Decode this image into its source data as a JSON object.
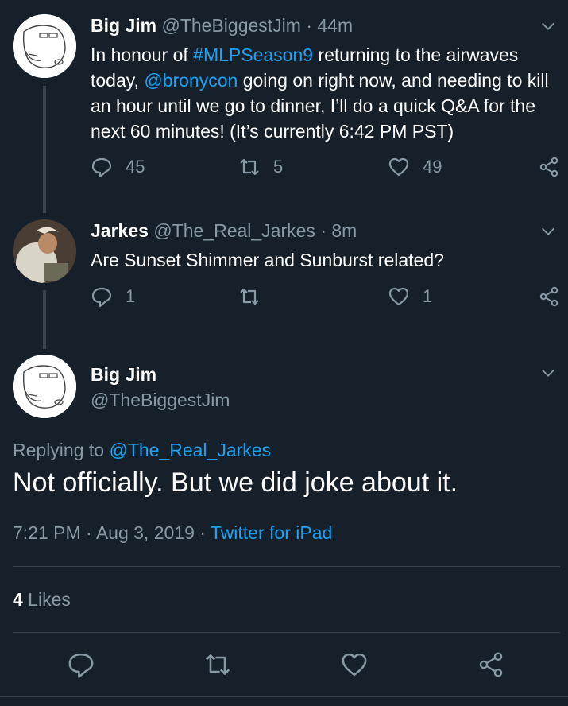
{
  "colors": {
    "background": "#15202b",
    "link": "#1da1f2",
    "muted": "#8899a6",
    "divider": "#38444d"
  },
  "tweet1": {
    "name": "Big Jim",
    "handle": "@TheBiggestJim",
    "separator": "·",
    "time": "44m",
    "text_before_hashtag": "In honour of ",
    "hashtag": "#MLPSeason9",
    "text_middle": " returning to the airwaves today, ",
    "mention": "@bronycon",
    "text_after": " going on right now, and needing to kill an hour until we go to dinner, I’ll do a quick Q&A for the next 60 minutes! (It’s currently 6:42 PM PST)",
    "replies": "45",
    "retweets": "5",
    "likes": "49"
  },
  "tweet2": {
    "name": "Jarkes",
    "handle": "@The_Real_Jarkes",
    "separator": "·",
    "time": "8m",
    "text": "Are Sunset Shimmer and Sunburst related?",
    "replies": "1",
    "retweets": "",
    "likes": "1"
  },
  "main_tweet": {
    "name": "Big Jim",
    "handle": "@TheBiggestJim",
    "replying_prefix": "Replying to ",
    "replying_to": "@The_Real_Jarkes",
    "text": "Not officially. But we did joke about it.",
    "timestamp": "7:21 PM · Aug 3, 2019 · ",
    "source": "Twitter for iPad",
    "likes_count": "4",
    "likes_label": " Likes"
  },
  "icons": {
    "reply": "reply-icon",
    "retweet": "retweet-icon",
    "like": "heart-icon",
    "share": "share-icon",
    "menu": "chevron-down-icon"
  }
}
